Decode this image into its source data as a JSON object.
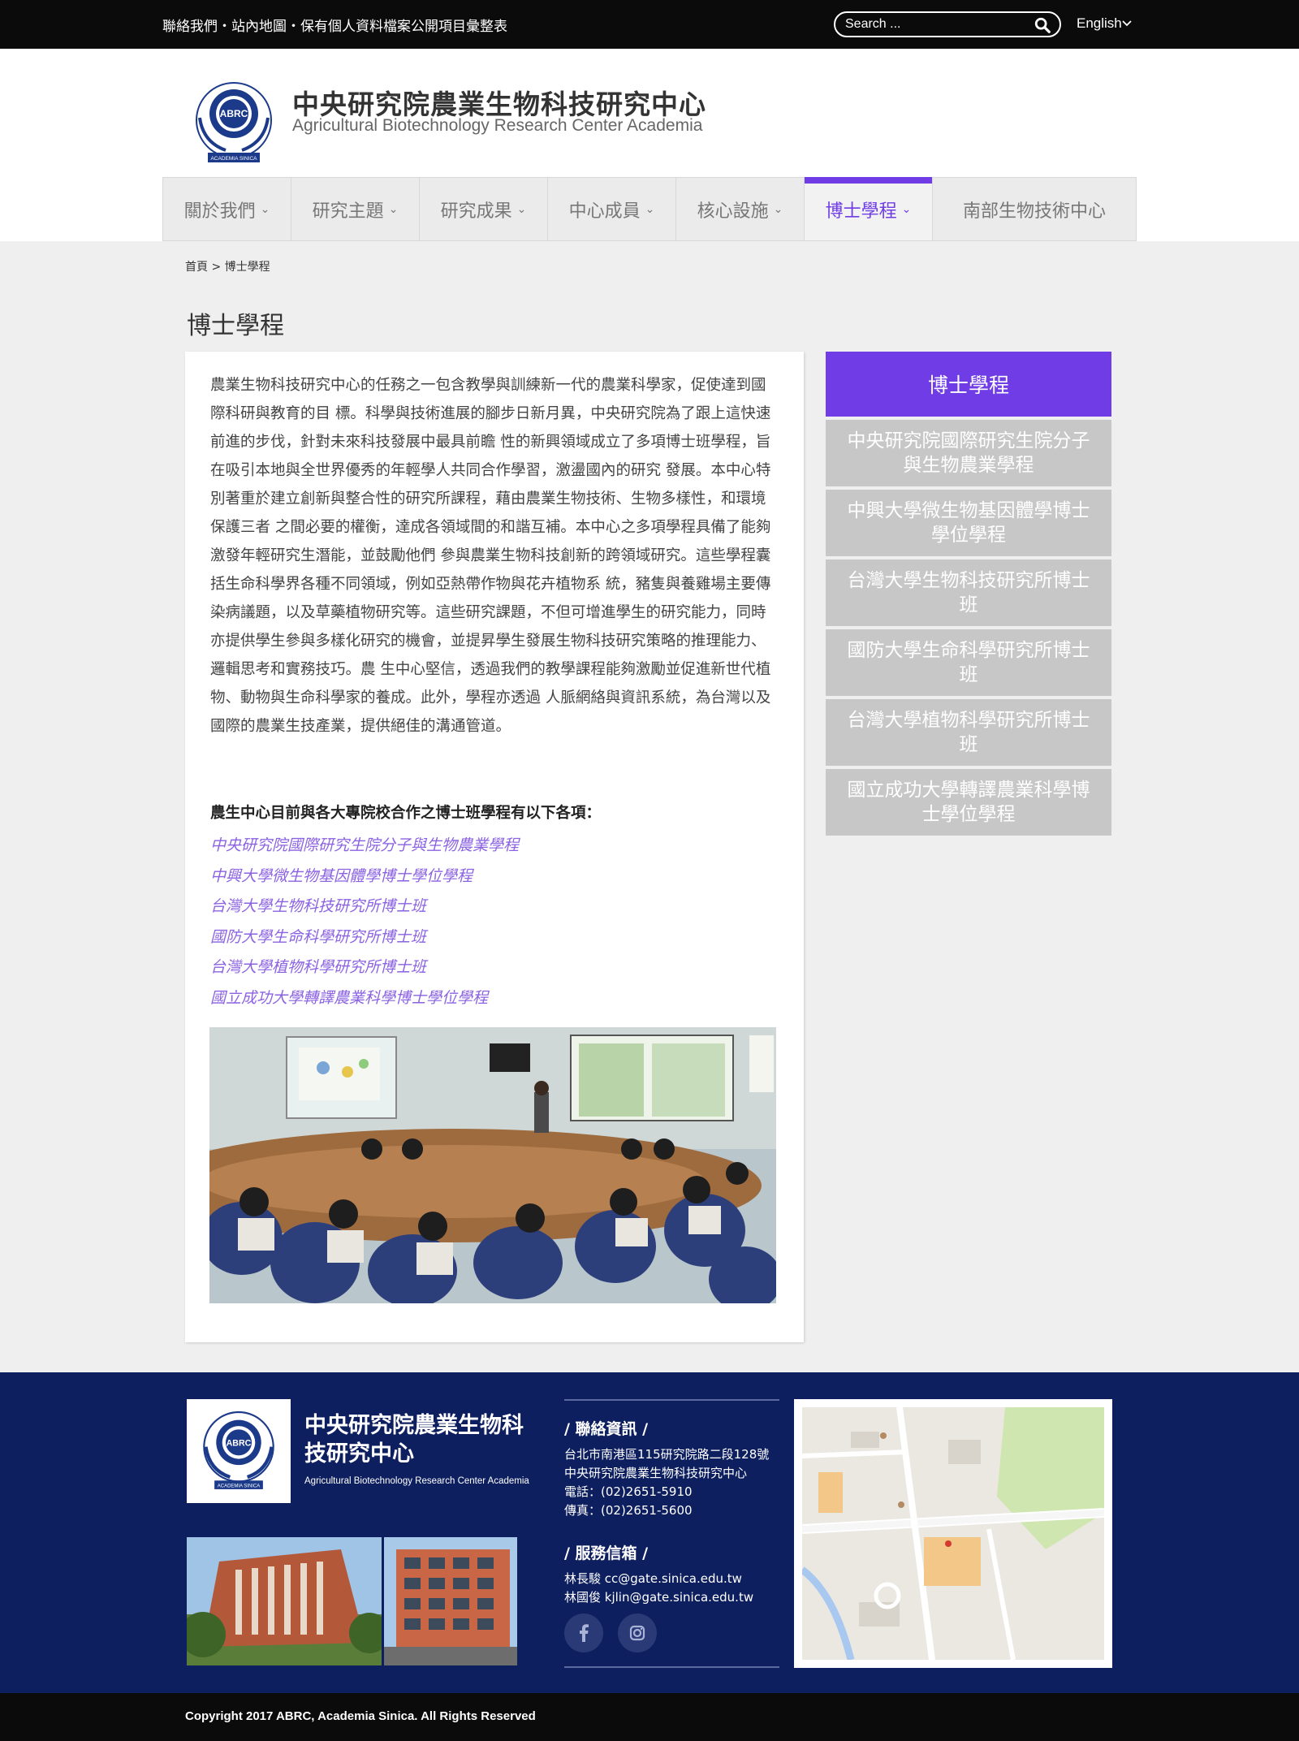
{
  "topbar": {
    "links": "聯絡我們・站內地圖・保有個人資料檔案公開項目彙整表",
    "search_placeholder": "Search ...",
    "lang": "English"
  },
  "header": {
    "title": "中央研究院農業生物科技研究中心",
    "subtitle": "Agricultural Biotechnology Research Center Academia",
    "logo_text": "ABRC",
    "logo_caption": "ACADEMIA SINICA"
  },
  "nav": {
    "items": [
      {
        "label": "關於我們",
        "dropdown": true
      },
      {
        "label": "研究主題",
        "dropdown": true
      },
      {
        "label": "研究成果",
        "dropdown": true
      },
      {
        "label": "中心成員",
        "dropdown": true
      },
      {
        "label": "核心設施",
        "dropdown": true
      },
      {
        "label": "博士學程",
        "dropdown": true,
        "active": true
      },
      {
        "label": "南部生物技術中心",
        "dropdown": false
      }
    ]
  },
  "breadcrumb": "首頁 > 博士學程",
  "page_title": "博士學程",
  "content": {
    "intro": "農業生物科技研究中心的任務之一包含教學與訓練新一代的農業科學家，促使達到國際科研與教育的目 標。科學與技術進展的腳步日新月異，中央研究院為了跟上這快速前進的步伐，針對未來科技發展中最具前瞻 性的新興領域成立了多項博士班學程，旨在吸引本地與全世界優秀的年輕學人共同合作學習，激盪國內的研究 發展。本中心特別著重於建立創新與整合性的研究所課程，藉由農業生物技術、生物多樣性，和環境保護三者 之間必要的權衡，達成各領域間的和諧互補。本中心之多項學程具備了能夠激發年輕研究生潛能，並鼓勵他們 參與農業生物科技創新的跨領域研究。這些學程囊括生命科學界各種不同領域，例如亞熱帶作物與花卉植物系 統，豬隻與養雞場主要傳染病議題，以及草藥植物研究等。這些研究課題，不但可增進學生的研究能力，同時 亦提供學生參與多樣化研究的機會，並提昇學生發展生物科技研究策略的推理能力、邏輯思考和實務技巧。農 生中心堅信，透過我們的教學課程能夠激勵並促進新世代植物、動物與生命科學家的養成。此外，學程亦透過 人脈網絡與資訊系統，為台灣以及國際的農業生技產業，提供絕佳的溝通管道。",
    "list_title": "農生中心目前與各大專院校合作之博士班學程有以下各項：",
    "programs": [
      "中央研究院國際研究生院分子與生物農業學程",
      "中興大學微生物基因體學博士學位學程",
      "台灣大學生物科技研究所博士班",
      "國防大學生命科學研究所博士班",
      "台灣大學植物科學研究所博士班",
      "國立成功大學轉譯農業科學博士學位學程"
    ]
  },
  "sidebar": {
    "heading": "博士學程",
    "items": [
      "中央研究院國際研究生院分子與生物農業學程",
      "中興大學微生物基因體學博士學位學程",
      "台灣大學生物科技研究所博士班",
      "國防大學生命科學研究所博士班",
      "台灣大學植物科學研究所博士班",
      "國立成功大學轉譯農業科學博士學位學程"
    ]
  },
  "footer": {
    "title": "中央研究院農業生物科技研究中心",
    "subtitle": "Agricultural Biotechnology Research Center Academia",
    "contact_heading": "/ 聯絡資訊 /",
    "address": "台北市南港區115研究院路二段128號",
    "org": "中央研究院農業生物科技研究中心",
    "phone": "電話：(02)2651-5910",
    "fax": "傳真：(02)2651-5600",
    "mail_heading": "/ 服務信箱 /",
    "mail1": "林長駿  cc@gate.sinica.edu.tw",
    "mail2": "林國俊  kjlin@gate.sinica.edu.tw"
  },
  "copyright": "Copyright 2017 ABRC, Academia Sinica. All Rights Reserved",
  "colors": {
    "accent": "#6f3ce6",
    "footer_bg": "#0d1f5f",
    "topbar_bg": "#0b0b0b",
    "link": "#8b62e2"
  }
}
